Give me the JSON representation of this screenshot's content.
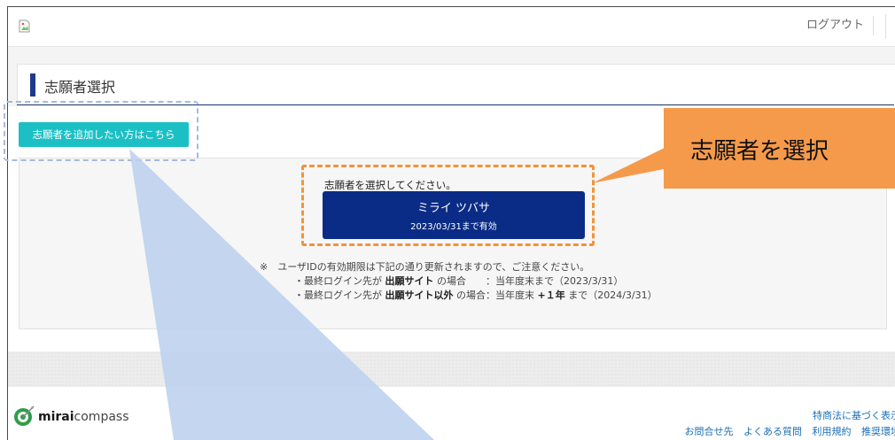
{
  "header": {
    "logout_label": "ログアウト"
  },
  "page": {
    "title": "志願者選択"
  },
  "actions": {
    "add_applicant_label": "志願者を追加したい方はこちら"
  },
  "selection": {
    "prompt": "志願者を選択してください。",
    "applicants": [
      {
        "name": "ミライ ツバサ",
        "validity": "2023/03/31まで有効"
      }
    ]
  },
  "notes": {
    "line1": "※　ユーザIDの有効期限は下記の通り更新されますので、ご注意ください。",
    "line2_prefix": "・最終ログイン先が ",
    "line2_bold": "出願サイト",
    "line2_suffix": " の場合　　：当年度末まで（2023/3/31）",
    "line3_prefix": "・最終ログイン先が ",
    "line3_bold": "出願サイト以外",
    "line3_mid": " の場合：当年度末 ",
    "line3_bold2": "+１年",
    "line3_suffix": " まで（2024/3/31）"
  },
  "footer": {
    "logo_bold": "mirai",
    "logo_rest": "compass",
    "link_top": "特商法に基づく表示",
    "links": [
      "お問合せ先",
      "よくある質問",
      "利用規約",
      "推奨環境"
    ]
  },
  "callout": {
    "text": "志願者を選択"
  },
  "colors": {
    "accent_teal": "#1cc0c4",
    "applicant_button": "#0b2c86",
    "callout_orange": "#f59a4a",
    "highlight_dash_orange": "#f0953c",
    "highlight_dash_blue": "#a7b9dd",
    "pointer_blue": "#bcd0ee"
  },
  "icons": {
    "header_image": "broken-image-icon",
    "footer_logo": "miraicompass-logo-icon"
  }
}
